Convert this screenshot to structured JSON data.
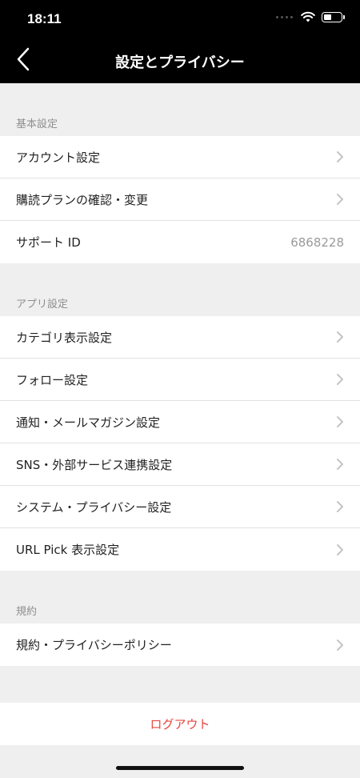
{
  "status_bar": {
    "time": "18:11"
  },
  "nav": {
    "title": "設定とプライバシー"
  },
  "sections": [
    {
      "header": "基本設定",
      "items": [
        {
          "label": "アカウント設定"
        },
        {
          "label": "購読プランの確認・変更"
        },
        {
          "label": "サポート ID",
          "value": "6868228"
        }
      ]
    },
    {
      "header": "アプリ設定",
      "items": [
        {
          "label": "カテゴリ表示設定"
        },
        {
          "label": "フォロー設定"
        },
        {
          "label": "通知・メールマガジン設定"
        },
        {
          "label": "SNS・外部サービス連携設定"
        },
        {
          "label": "システム・プライバシー設定"
        },
        {
          "label": "URL Pick 表示設定"
        }
      ]
    },
    {
      "header": "規約",
      "items": [
        {
          "label": "規約・プライバシーポリシー"
        }
      ]
    }
  ],
  "logout": {
    "label": "ログアウト"
  },
  "colors": {
    "accent_red": "#e7443c",
    "header_bg": "#000000",
    "background": "#efefef"
  },
  "icons": {
    "back": "chevron-left-icon",
    "row": "chevron-right-icon",
    "wifi": "wifi-icon",
    "battery": "battery-icon"
  }
}
